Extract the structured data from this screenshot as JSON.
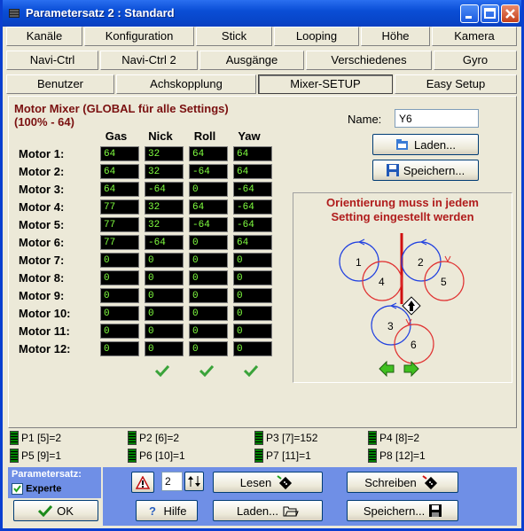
{
  "window": {
    "title": "Parametersatz 2 : Standard"
  },
  "tabs": {
    "row1": [
      "Kanäle",
      "Konfiguration",
      "Stick",
      "Looping",
      "Höhe",
      "Kamera"
    ],
    "row2": [
      "Navi-Ctrl",
      "Navi-Ctrl 2",
      "Ausgänge",
      "Verschiedenes",
      "Gyro"
    ],
    "row3": [
      "Benutzer",
      "Achskopplung",
      "Mixer-SETUP",
      "Easy Setup"
    ],
    "active": "Mixer-SETUP"
  },
  "mixer": {
    "title_line1": "Motor Mixer (GLOBAL für alle Settings)",
    "title_line2": "(100% - 64)",
    "columns": [
      "Gas",
      "Nick",
      "Roll",
      "Yaw"
    ],
    "motors": [
      {
        "label": "Motor 1:",
        "values": [
          "64",
          "32",
          "64",
          "64"
        ]
      },
      {
        "label": "Motor 2:",
        "values": [
          "64",
          "32",
          "-64",
          "64"
        ]
      },
      {
        "label": "Motor 3:",
        "values": [
          "64",
          "-64",
          "0",
          "-64"
        ]
      },
      {
        "label": "Motor 4:",
        "values": [
          "77",
          "32",
          "64",
          "-64"
        ]
      },
      {
        "label": "Motor 5:",
        "values": [
          "77",
          "32",
          "-64",
          "-64"
        ]
      },
      {
        "label": "Motor 6:",
        "values": [
          "77",
          "-64",
          "0",
          "64"
        ]
      },
      {
        "label": "Motor 7:",
        "values": [
          "0",
          "0",
          "0",
          "0"
        ]
      },
      {
        "label": "Motor 8:",
        "values": [
          "0",
          "0",
          "0",
          "0"
        ]
      },
      {
        "label": "Motor 9:",
        "values": [
          "0",
          "0",
          "0",
          "0"
        ]
      },
      {
        "label": "Motor 10:",
        "values": [
          "0",
          "0",
          "0",
          "0"
        ]
      },
      {
        "label": "Motor 11:",
        "values": [
          "0",
          "0",
          "0",
          "0"
        ]
      },
      {
        "label": "Motor 12:",
        "values": [
          "0",
          "0",
          "0",
          "0"
        ]
      }
    ]
  },
  "name_field": {
    "label": "Name:",
    "value": "Y6"
  },
  "buttons": {
    "laden": "Laden...",
    "speichern": "Speichern..."
  },
  "orientation": {
    "text_line1": "Orientierung muss in jedem",
    "text_line2": "Setting eingestellt werden",
    "rotor_labels": [
      "1",
      "2",
      "3",
      "4",
      "5",
      "6"
    ]
  },
  "params": [
    "P1 [5]=2",
    "P2 [6]=2",
    "P3 [7]=152",
    "P4 [8]=2",
    "P5 [9]=1",
    "P6 [10]=1",
    "P7 [11]=1",
    "P8 [12]=1"
  ],
  "footer": {
    "parametersatz_label": "Parametersatz:",
    "experte_label": "Experte",
    "experte_checked": true,
    "ok_label": "OK",
    "hilfe_label": "Hilfe",
    "set_number": "2",
    "lesen_label": "Lesen",
    "schreiben_label": "Schreiben",
    "laden_label": "Laden...",
    "speichern_label": "Speichern..."
  },
  "colors": {
    "title_bg": "#0a4ed6",
    "cell_text": "#80ff40",
    "mixer_title": "#7a1010",
    "orient_text": "#b01c1c"
  }
}
